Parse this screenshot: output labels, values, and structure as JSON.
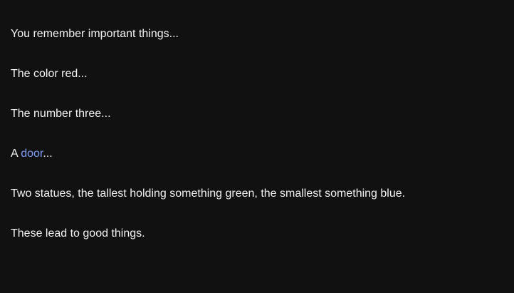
{
  "passage": {
    "line1": "You remember important things...",
    "line2": "The color red...",
    "line3": "The number three...",
    "line4_prefix": "A ",
    "line4_link": "door",
    "line4_suffix": "...",
    "line5": "Two statues, the tallest holding something green, the smallest something blue.",
    "line6": "These lead to good things."
  },
  "colors": {
    "background": "#111111",
    "text": "#f2f2f2",
    "link": "#7f9cf5"
  }
}
